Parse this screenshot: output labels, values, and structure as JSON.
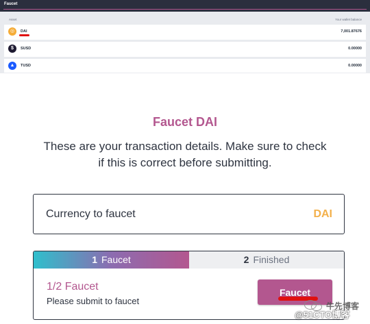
{
  "topbar": {
    "title": "Faucet"
  },
  "asset_list": {
    "header_asset": "Asset",
    "header_balance": "Your wallet balance",
    "rows": [
      {
        "symbol": "DAI",
        "icon": "dai-coin-icon",
        "icon_glyph": "◎",
        "balance": "7,001.87676"
      },
      {
        "symbol": "SUSD",
        "icon": "susd-coin-icon",
        "icon_glyph": "$",
        "balance": "0.00000"
      },
      {
        "symbol": "TUSD",
        "icon": "tusd-coin-icon",
        "icon_glyph": "▲",
        "balance": "0.00000"
      }
    ]
  },
  "modal": {
    "title": "Faucet DAI",
    "description": "These are your transaction details. Make sure to check if this is correct before submitting.",
    "currency_label": "Currency to faucet",
    "currency_value": "DAI",
    "steps": [
      {
        "number": "1",
        "label": "Faucet",
        "active": true
      },
      {
        "number": "2",
        "label": "Finished",
        "active": false
      }
    ],
    "progress_title": "1/2 Faucet",
    "progress_subtitle": "Please submit to faucet",
    "button_label": "Faucet"
  },
  "watermark": {
    "line1": "牛先博客",
    "line2": "@51CTO博客"
  },
  "colors": {
    "accent": "#b3578f",
    "dai_orange": "#f3b04a",
    "topbar": "#2b2f3e",
    "step_gradient_start": "#2fbfcc",
    "panel_bg": "#e9ebef"
  }
}
